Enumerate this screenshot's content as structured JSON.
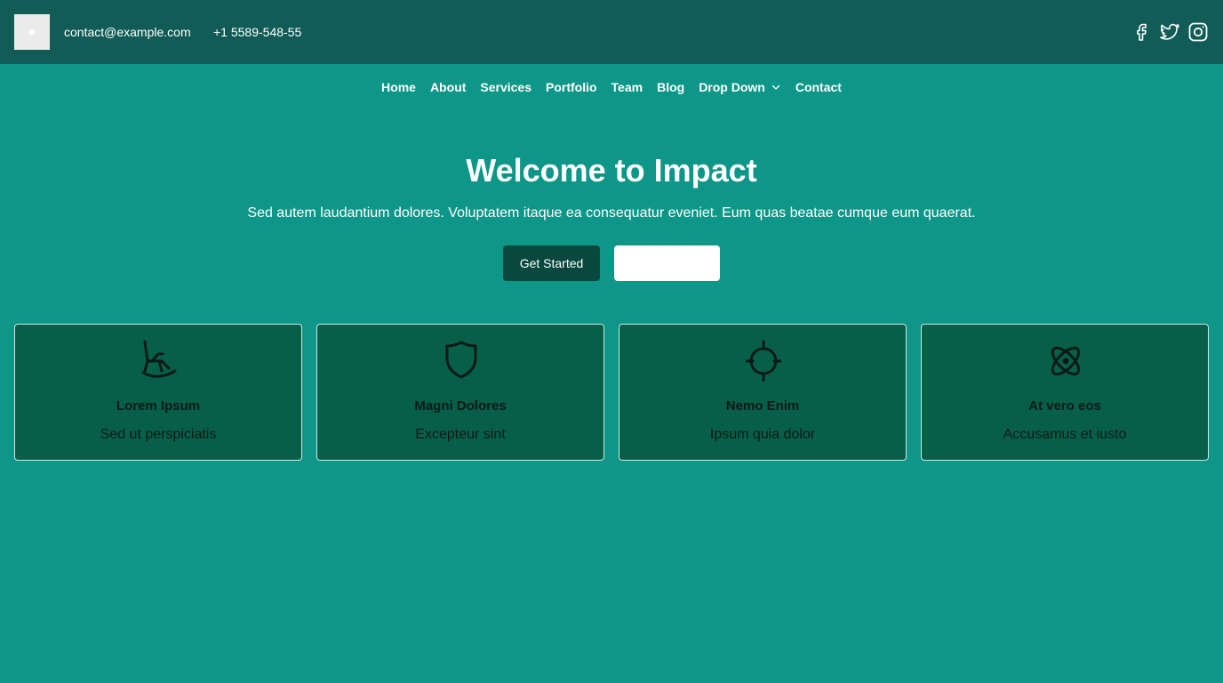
{
  "header": {
    "email": "contact@example.com",
    "phone": "+1 5589-548-55",
    "socials": [
      "facebook-icon",
      "twitter-icon",
      "instagram-icon"
    ]
  },
  "nav": {
    "items": [
      "Home",
      "About",
      "Services",
      "Portfolio",
      "Team",
      "Blog",
      "Drop Down",
      "Contact"
    ]
  },
  "hero": {
    "title": "Welcome to Impact",
    "subtitle": "Sed autem laudantium dolores. Voluptatem itaque ea consequatur eveniet. Eum quas beatae cumque eum quaerat.",
    "primary_button": "Get Started",
    "secondary_button": ""
  },
  "cards": [
    {
      "icon": "rocking-chair-icon",
      "title": "Lorem Ipsum",
      "desc": "Sed ut perspiciatis"
    },
    {
      "icon": "shield-icon",
      "title": "Magni Dolores",
      "desc": "Excepteur sint"
    },
    {
      "icon": "crosshair-icon",
      "title": "Nemo Enim",
      "desc": "Ipsum quia dolor"
    },
    {
      "icon": "atom-icon",
      "title": "At vero eos",
      "desc": "Accusamus et iusto"
    }
  ],
  "colors": {
    "background": "#0e9688",
    "topbar": "#125c58",
    "primary_button": "#08483e",
    "card": "#075f48"
  }
}
